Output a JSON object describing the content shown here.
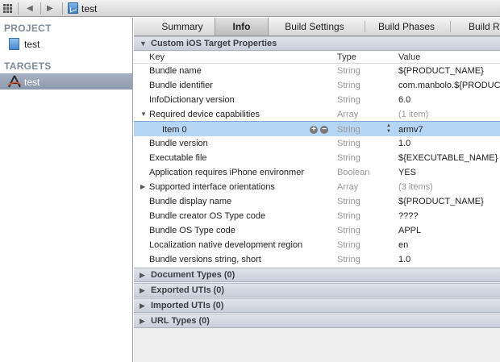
{
  "jumpbar": {
    "label": "test"
  },
  "sidebar": {
    "project_header": "PROJECT",
    "project_item": "test",
    "targets_header": "TARGETS",
    "target_item": "test"
  },
  "tabs": [
    {
      "label": "Summary"
    },
    {
      "label": "Info"
    },
    {
      "label": "Build Settings"
    },
    {
      "label": "Build Phases"
    },
    {
      "label": "Build Ru"
    }
  ],
  "custom_section": {
    "title": "Custom iOS Target Properties",
    "columns": {
      "key": "Key",
      "type": "Type",
      "value": "Value"
    },
    "rows": [
      {
        "key": "Bundle name",
        "type": "String",
        "value": "${PRODUCT_NAME}"
      },
      {
        "key": "Bundle identifier",
        "type": "String",
        "value": "com.manbolo.${PRODUC"
      },
      {
        "key": "InfoDictionary version",
        "type": "String",
        "value": "6.0"
      },
      {
        "key": "Required device capabilities",
        "type": "Array",
        "value": "(1 item)"
      },
      {
        "key": "Item 0",
        "type": "String",
        "value": "armv7"
      },
      {
        "key": "Bundle version",
        "type": "String",
        "value": "1.0"
      },
      {
        "key": "Executable file",
        "type": "String",
        "value": "${EXECUTABLE_NAME}"
      },
      {
        "key": "Application requires iPhone environmer",
        "type": "Boolean",
        "value": "YES"
      },
      {
        "key": "Supported interface orientations",
        "type": "Array",
        "value": "(3 items)"
      },
      {
        "key": "Bundle display name",
        "type": "String",
        "value": "${PRODUCT_NAME}"
      },
      {
        "key": "Bundle creator OS Type code",
        "type": "String",
        "value": "????"
      },
      {
        "key": "Bundle OS Type code",
        "type": "String",
        "value": "APPL"
      },
      {
        "key": "Localization native development region",
        "type": "String",
        "value": "en"
      },
      {
        "key": "Bundle versions string, short",
        "type": "String",
        "value": "1.0"
      }
    ]
  },
  "sections": [
    {
      "title": "Document Types (0)"
    },
    {
      "title": "Exported UTIs (0)"
    },
    {
      "title": "Imported UTIs (0)"
    },
    {
      "title": "URL Types (0)"
    }
  ],
  "colors": {
    "selection": "#b5d5f5",
    "sidebar_selection": "#8c98ad",
    "section_header": "#c9cfd9"
  }
}
